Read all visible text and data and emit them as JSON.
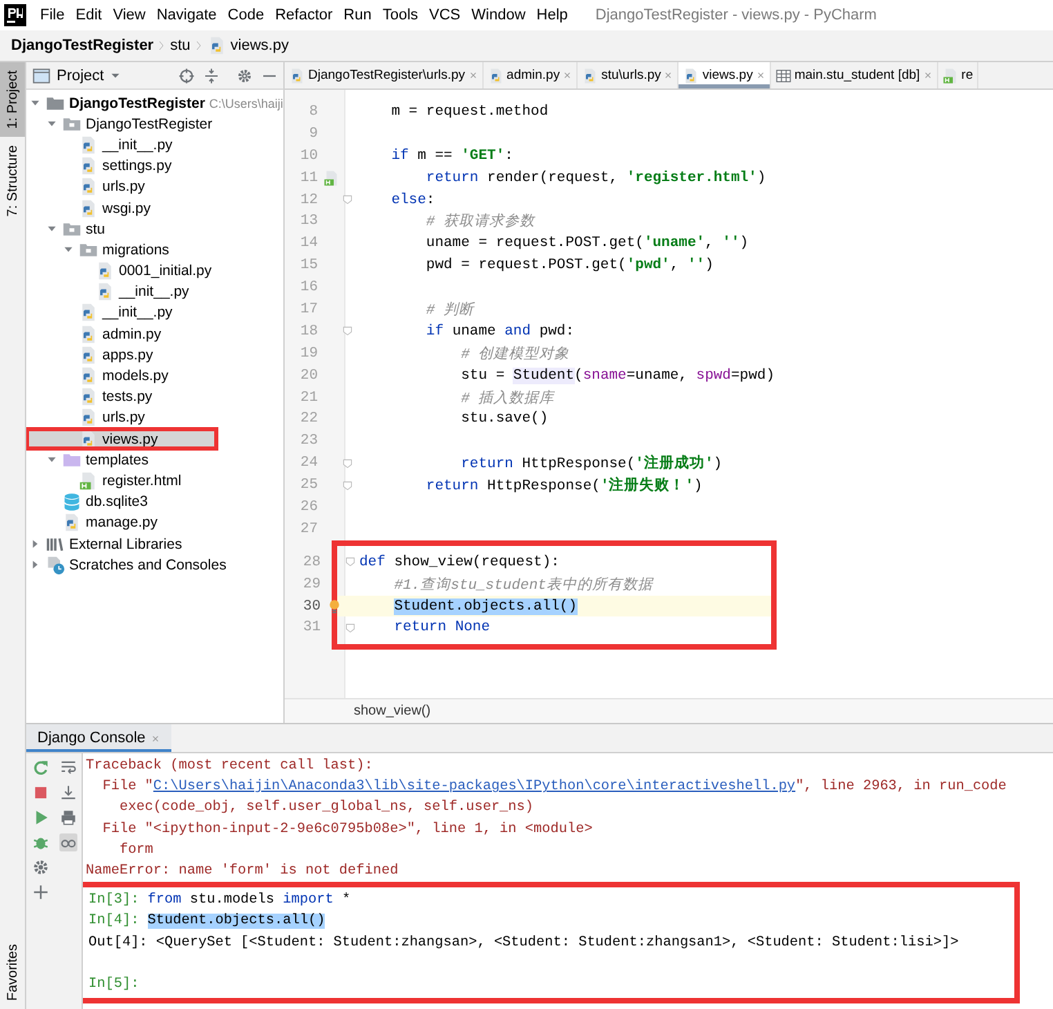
{
  "window": {
    "title": "DjangoTestRegister - views.py - PyCharm"
  },
  "menu": [
    "File",
    "Edit",
    "View",
    "Navigate",
    "Code",
    "Refactor",
    "Run",
    "Tools",
    "VCS",
    "Window",
    "Help"
  ],
  "breadcrumb": [
    "DjangoTestRegister",
    "stu",
    "views.py"
  ],
  "side_stripe": {
    "top": [
      {
        "label": "1: Project",
        "selected": true
      },
      {
        "label": "7: Structure",
        "selected": false
      }
    ],
    "bottom": [
      {
        "label": "Favorites",
        "selected": false
      }
    ]
  },
  "project_panel": {
    "title": "Project",
    "tree": [
      {
        "label": "DjangoTestRegister",
        "hint": "C:\\Users\\haiji",
        "kind": "folder",
        "bold": true,
        "expanded": true,
        "selected": false,
        "boxed": false,
        "children": [
          {
            "label": "DjangoTestRegister",
            "kind": "package",
            "bold": false,
            "expanded": true,
            "selected": false,
            "boxed": false,
            "children": [
              {
                "label": "__init__.py",
                "kind": "python",
                "bold": false,
                "selected": false,
                "boxed": false
              },
              {
                "label": "settings.py",
                "kind": "python",
                "bold": false,
                "selected": false,
                "boxed": false
              },
              {
                "label": "urls.py",
                "kind": "python",
                "bold": false,
                "selected": false,
                "boxed": false
              },
              {
                "label": "wsgi.py",
                "kind": "python",
                "bold": false,
                "selected": false,
                "boxed": false
              }
            ]
          },
          {
            "label": "stu",
            "kind": "package",
            "bold": false,
            "expanded": true,
            "selected": false,
            "boxed": false,
            "children": [
              {
                "label": "migrations",
                "kind": "package",
                "bold": false,
                "expanded": true,
                "selected": false,
                "boxed": false,
                "children": [
                  {
                    "label": "0001_initial.py",
                    "kind": "python",
                    "bold": false,
                    "selected": false,
                    "boxed": false
                  },
                  {
                    "label": "__init__.py",
                    "kind": "python",
                    "bold": false,
                    "selected": false,
                    "boxed": false
                  }
                ]
              },
              {
                "label": "__init__.py",
                "kind": "python",
                "bold": false,
                "selected": false,
                "boxed": false
              },
              {
                "label": "admin.py",
                "kind": "python",
                "bold": false,
                "selected": false,
                "boxed": false
              },
              {
                "label": "apps.py",
                "kind": "python",
                "bold": false,
                "selected": false,
                "boxed": false
              },
              {
                "label": "models.py",
                "kind": "python",
                "bold": false,
                "selected": false,
                "boxed": false
              },
              {
                "label": "tests.py",
                "kind": "python",
                "bold": false,
                "selected": false,
                "boxed": false
              },
              {
                "label": "urls.py",
                "kind": "python",
                "bold": false,
                "selected": false,
                "boxed": false
              },
              {
                "label": "views.py",
                "kind": "python",
                "bold": false,
                "selected": true,
                "boxed": true
              }
            ]
          },
          {
            "label": "templates",
            "kind": "templates",
            "bold": false,
            "expanded": true,
            "selected": false,
            "boxed": false,
            "children": [
              {
                "label": "register.html",
                "kind": "html",
                "bold": false,
                "selected": false,
                "boxed": false
              }
            ]
          },
          {
            "label": "db.sqlite3",
            "kind": "database",
            "bold": false,
            "selected": false,
            "boxed": false
          },
          {
            "label": "manage.py",
            "kind": "python",
            "bold": false,
            "selected": false,
            "boxed": false
          }
        ]
      },
      {
        "label": "External Libraries",
        "kind": "library",
        "bold": false,
        "expanded": false,
        "selected": false,
        "boxed": false
      },
      {
        "label": "Scratches and Consoles",
        "kind": "scratch",
        "bold": false,
        "expanded": false,
        "selected": false,
        "boxed": false
      }
    ]
  },
  "editor": {
    "tabs": [
      {
        "label": "DjangoTestRegister\\urls.py",
        "kind": "python",
        "selected": false
      },
      {
        "label": "admin.py",
        "kind": "python",
        "selected": false
      },
      {
        "label": "stu\\urls.py",
        "kind": "python",
        "selected": false
      },
      {
        "label": "views.py",
        "kind": "python",
        "selected": true
      },
      {
        "label": "main.stu_student [db]",
        "kind": "table",
        "selected": false
      },
      {
        "label": "re",
        "kind": "html",
        "selected": false
      }
    ],
    "lines": [
      {
        "n": "8",
        "kind": "plain",
        "current": false,
        "tokens": [
          {
            "kind": "plain",
            "text": "    m = request.method"
          }
        ]
      },
      {
        "n": "9",
        "kind": "plain",
        "current": false
      },
      {
        "n": "10",
        "kind": "plain",
        "current": false,
        "tokens": [
          {
            "kind": "keyword",
            "text": "    if"
          },
          {
            "kind": "plain",
            "text": " m == "
          },
          {
            "kind": "string",
            "text": "'GET'"
          },
          {
            "kind": "plain",
            "text": ":"
          }
        ]
      },
      {
        "n": "11",
        "kind": "html",
        "current": false,
        "tokens": [
          {
            "kind": "keyword",
            "text": "        return"
          },
          {
            "kind": "plain",
            "text": " render(request, "
          },
          {
            "kind": "string",
            "text": "'register.html'"
          },
          {
            "kind": "plain",
            "text": ")"
          }
        ]
      },
      {
        "n": "12",
        "kind": "fold",
        "current": false,
        "tokens": [
          {
            "kind": "keyword",
            "text": "    else"
          },
          {
            "kind": "plain",
            "text": ":"
          }
        ]
      },
      {
        "n": "13",
        "kind": "plain",
        "current": false,
        "tokens": [
          {
            "kind": "comment",
            "text": "        # 获取请求参数"
          }
        ]
      },
      {
        "n": "14",
        "kind": "plain",
        "current": false,
        "tokens": [
          {
            "kind": "plain",
            "text": "        uname = request.POST.get("
          },
          {
            "kind": "string",
            "text": "'uname'"
          },
          {
            "kind": "plain",
            "text": ", "
          },
          {
            "kind": "string",
            "text": "''"
          },
          {
            "kind": "plain",
            "text": ")"
          }
        ]
      },
      {
        "n": "15",
        "kind": "plain",
        "current": false,
        "tokens": [
          {
            "kind": "plain",
            "text": "        pwd = request.POST.get("
          },
          {
            "kind": "string",
            "text": "'pwd'"
          },
          {
            "kind": "plain",
            "text": ", "
          },
          {
            "kind": "string",
            "text": "''"
          },
          {
            "kind": "plain",
            "text": ")"
          }
        ]
      },
      {
        "n": "16",
        "kind": "plain",
        "current": false
      },
      {
        "n": "17",
        "kind": "plain",
        "current": false,
        "tokens": [
          {
            "kind": "comment",
            "text": "        # 判断"
          }
        ]
      },
      {
        "n": "18",
        "kind": "fold",
        "current": false,
        "tokens": [
          {
            "kind": "keyword",
            "text": "        if"
          },
          {
            "kind": "plain",
            "text": " uname "
          },
          {
            "kind": "keyword",
            "text": "and"
          },
          {
            "kind": "plain",
            "text": " pwd:"
          }
        ]
      },
      {
        "n": "19",
        "kind": "plain",
        "current": false,
        "tokens": [
          {
            "kind": "comment",
            "text": "            # 创建模型对象"
          }
        ]
      },
      {
        "n": "20",
        "kind": "plain",
        "current": false,
        "tokens": [
          {
            "kind": "plain",
            "text": "            stu = "
          },
          {
            "kind": "usage",
            "text": "Student"
          },
          {
            "kind": "plain",
            "text": "("
          },
          {
            "kind": "param",
            "text": "sname"
          },
          {
            "kind": "plain",
            "text": "=uname, "
          },
          {
            "kind": "param",
            "text": "spwd"
          },
          {
            "kind": "plain",
            "text": "=pwd)"
          }
        ]
      },
      {
        "n": "21",
        "kind": "plain",
        "current": false,
        "tokens": [
          {
            "kind": "comment",
            "text": "            # 插入数据库"
          }
        ]
      },
      {
        "n": "22",
        "kind": "plain",
        "current": false,
        "tokens": [
          {
            "kind": "plain",
            "text": "            stu.save()"
          }
        ]
      },
      {
        "n": "23",
        "kind": "plain",
        "current": false
      },
      {
        "n": "24",
        "kind": "fold",
        "current": false,
        "tokens": [
          {
            "kind": "keyword",
            "text": "            return"
          },
          {
            "kind": "plain",
            "text": " HttpResponse("
          },
          {
            "kind": "string",
            "text": "'注册成功'"
          },
          {
            "kind": "plain",
            "text": ")"
          }
        ]
      },
      {
        "n": "25",
        "kind": "fold",
        "current": false,
        "tokens": [
          {
            "kind": "keyword",
            "text": "        return"
          },
          {
            "kind": "plain",
            "text": " HttpResponse("
          },
          {
            "kind": "string",
            "text": "'注册失败！'"
          },
          {
            "kind": "plain",
            "text": ")"
          }
        ]
      },
      {
        "n": "26",
        "kind": "plain",
        "current": false
      },
      {
        "n": "27",
        "kind": "plain",
        "current": false
      }
    ],
    "highlight_box": {
      "lines": [
        {
          "n": "28",
          "kind": "fold",
          "current": false,
          "tokens": [
            {
              "kind": "keyword",
              "text": "def"
            },
            {
              "kind": "plain",
              "text": " show_view(request):"
            }
          ]
        },
        {
          "n": "29",
          "kind": "plain",
          "current": false,
          "tokens": [
            {
              "kind": "comment",
              "text": "    #1.查询stu_student表中的所有数据"
            }
          ]
        },
        {
          "n": "30",
          "kind": "bulb",
          "current": true,
          "tokens": [
            {
              "kind": "selection",
              "text": "Student.objects.all()"
            }
          ]
        },
        {
          "n": "31",
          "kind": "fold",
          "current": false,
          "tokens": [
            {
              "kind": "keyword",
              "text": "    return"
            },
            {
              "kind": "keyword",
              "text": " None"
            }
          ]
        }
      ]
    },
    "breadcrumb": "show_view()"
  },
  "console": {
    "tab": "Django Console",
    "lines": [
      {
        "tokens": [
          {
            "kind": "error",
            "text": "Traceback (most recent call last):"
          }
        ]
      },
      {
        "tokens": [
          {
            "kind": "error",
            "text": "  File \""
          },
          {
            "kind": "link",
            "text": "C:\\Users\\haijin\\Anaconda3\\lib\\site-packages\\IPython\\core\\interactiveshell.py"
          },
          {
            "kind": "error",
            "text": "\", line 2963, in run_code"
          }
        ]
      },
      {
        "tokens": [
          {
            "kind": "error",
            "text": "    exec(code_obj, self.user_global_ns, self.user_ns)"
          }
        ]
      },
      {
        "tokens": [
          {
            "kind": "error",
            "text": "  File \"<ipython-input-2-9e6c0795b08e>\", line 1, in <module>"
          }
        ]
      },
      {
        "tokens": [
          {
            "kind": "error",
            "text": "    form"
          }
        ]
      },
      {
        "tokens": [
          {
            "kind": "error",
            "text": "NameError: name 'form' is not defined"
          }
        ]
      }
    ],
    "highlight_box": {
      "lines": [
        {
          "tokens": [
            {
              "kind": "prompt",
              "text": "In[3]: "
            },
            {
              "kind": "keyword",
              "text": "from"
            },
            {
              "kind": "plain",
              "text": " stu.models "
            },
            {
              "kind": "keyword",
              "text": "import"
            },
            {
              "kind": "plain",
              "text": " *"
            }
          ]
        },
        {
          "tokens": [
            {
              "kind": "prompt",
              "text": "In[4]: "
            },
            {
              "kind": "selection",
              "text": "Student.objects.all()"
            }
          ]
        },
        {
          "tokens": [
            {
              "kind": "plain",
              "text": "Out[4]: <QuerySet [<Student: Student:zhangsan>, <Student: Student:zhangsan1>, <Student: Student:lisi>]>"
            }
          ]
        },
        {
          "kind": "blank"
        },
        {
          "tokens": [
            {
              "kind": "prompt",
              "text": "In[5]:"
            }
          ]
        }
      ]
    }
  }
}
